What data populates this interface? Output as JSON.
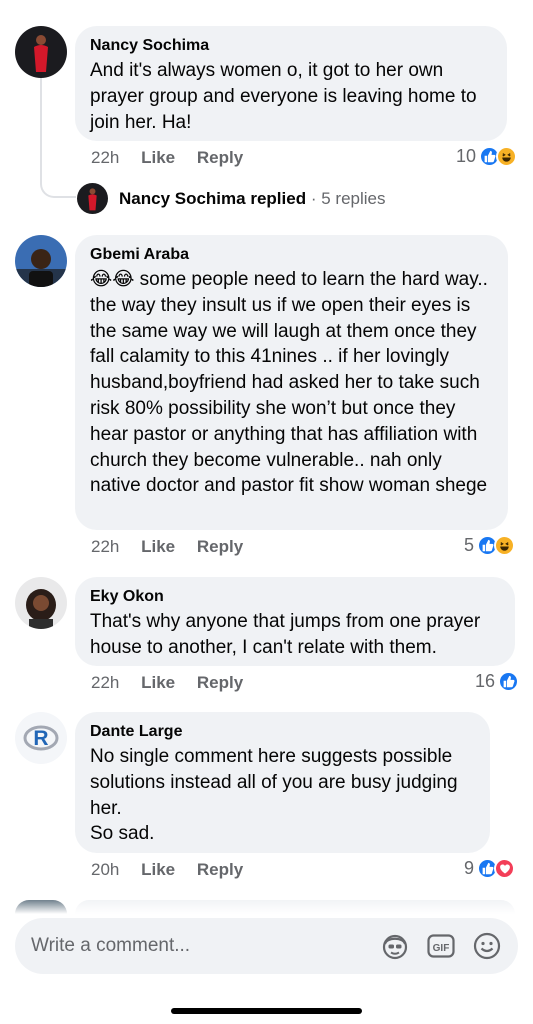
{
  "comments": [
    {
      "author": "Nancy Sochima",
      "text": "And it's always women o, it got to her own prayer group and everyone is leaving home to join her. Ha!",
      "time": "22h",
      "like": "Like",
      "reply": "Reply",
      "reaction_count": "10",
      "reactions": [
        "like-icon",
        "haha-icon"
      ],
      "replies": {
        "author": "Nancy Sochima",
        "action": "replied",
        "sep": "·",
        "count": "5 replies"
      }
    },
    {
      "author": "Gbemi Araba",
      "emoji": "😂😂",
      "text": " some people need to learn the hard way.. the way they insult us if we open their eyes is the same way we will laugh at them once they fall calamity to this 41nines .. if her lovingly husband,boyfriend had asked her to take such risk 80% possibility she won’t but once they hear pastor or anything that has affiliation with church they become vulnerable.. nah only native doctor and pastor fit show woman shege",
      "time": "22h",
      "like": "Like",
      "reply": "Reply",
      "reaction_count": "5",
      "reactions": [
        "like-icon",
        "haha-icon"
      ]
    },
    {
      "author": "Eky Okon",
      "text": "That's why anyone that jumps from one prayer house to another, I can't relate with them.",
      "time": "22h",
      "like": "Like",
      "reply": "Reply",
      "reaction_count": "16",
      "reactions": [
        "like-icon"
      ]
    },
    {
      "author": "Dante Large",
      "text": "No single comment here suggests possible solutions instead all of you are busy judging her.\nSo sad.",
      "time": "20h",
      "like": "Like",
      "reply": "Reply",
      "reaction_count": "9",
      "reactions": [
        "like-icon",
        "love-icon"
      ]
    }
  ],
  "composer": {
    "placeholder": "Write a comment...",
    "icons": [
      "avatar-sticker-icon",
      "gif-icon",
      "emoji-icon"
    ]
  },
  "colors": {
    "bubble": "#f0f2f5",
    "meta": "#65676b",
    "like": "#1877f2",
    "haha": "#f7b125",
    "love": "#f33e58"
  }
}
